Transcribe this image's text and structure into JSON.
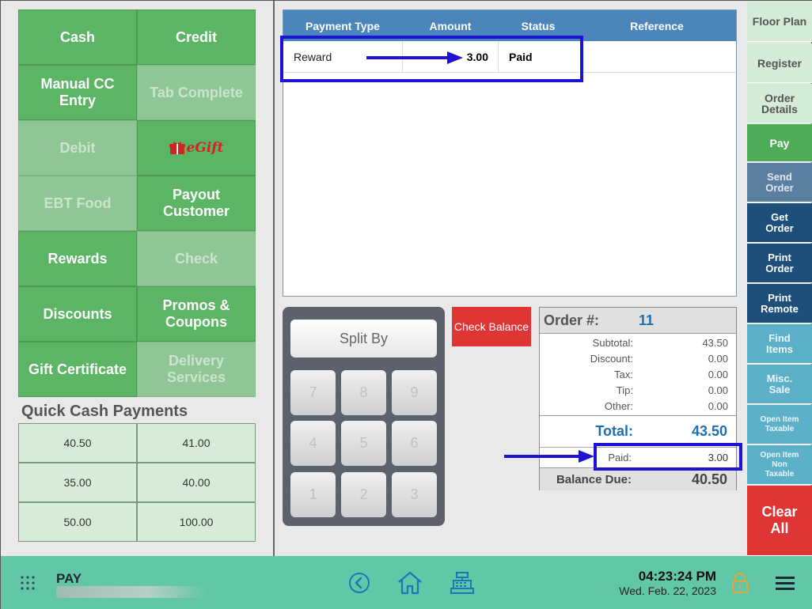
{
  "payment_buttons": [
    {
      "label": "Cash",
      "enabled": true
    },
    {
      "label": "Credit",
      "enabled": true
    },
    {
      "label": "Manual CC Entry",
      "enabled": true
    },
    {
      "label": "Tab Complete",
      "enabled": false
    },
    {
      "label": "Debit",
      "enabled": false
    },
    {
      "label": "eGift",
      "enabled": true
    },
    {
      "label": "EBT Food",
      "enabled": false
    },
    {
      "label": "Payout Customer",
      "enabled": true
    },
    {
      "label": "Rewards",
      "enabled": true
    },
    {
      "label": "Check",
      "enabled": false
    },
    {
      "label": "Discounts",
      "enabled": true
    },
    {
      "label": "Promos & Coupons",
      "enabled": true
    },
    {
      "label": "Gift Certificate",
      "enabled": true
    },
    {
      "label": "Delivery Services",
      "enabled": false
    }
  ],
  "quick_cash": {
    "title": "Quick Cash Payments",
    "amounts": [
      "40.50",
      "41.00",
      "35.00",
      "40.00",
      "50.00",
      "100.00"
    ]
  },
  "payment_table": {
    "headers": [
      "Payment Type",
      "Amount",
      "Status",
      "Reference"
    ],
    "rows": [
      {
        "type": "Reward",
        "amount": "3.00",
        "status": "Paid",
        "reference": ""
      }
    ]
  },
  "keypad": {
    "split_label": "Split By",
    "keys": [
      "7",
      "8",
      "9",
      "4",
      "5",
      "6",
      "1",
      "2",
      "3"
    ]
  },
  "check_balance_label": "Check Balance",
  "summary": {
    "order_label": "Order #:",
    "order_number": "11",
    "lines": [
      {
        "label": "Subtotal:",
        "value": "43.50"
      },
      {
        "label": "Discount:",
        "value": "0.00"
      },
      {
        "label": "Tax:",
        "value": "0.00"
      },
      {
        "label": "Tip:",
        "value": "0.00"
      },
      {
        "label": "Other:",
        "value": "0.00"
      }
    ],
    "total_label": "Total:",
    "total_value": "43.50",
    "paid_label": "Paid:",
    "paid_value": "3.00",
    "due_label": "Balance Due:",
    "due_value": "40.50"
  },
  "sidebar": [
    {
      "label": "Floor Plan",
      "style": "light"
    },
    {
      "label": "Register",
      "style": "light"
    },
    {
      "label": "Order Details",
      "style": "light"
    },
    {
      "label": "Pay",
      "style": "green"
    },
    {
      "label": "Send Order",
      "style": "slate"
    },
    {
      "label": "Get Order",
      "style": "navy"
    },
    {
      "label": "Print Order",
      "style": "navy"
    },
    {
      "label": "Print Remote",
      "style": "navy"
    },
    {
      "label": "Find Items",
      "style": "teal"
    },
    {
      "label": "Misc. Sale",
      "style": "teal"
    },
    {
      "label": "Open Item Taxable",
      "style": "teal-s"
    },
    {
      "label": "Open Item Non Taxable",
      "style": "teal-s"
    },
    {
      "label": "Clear All",
      "style": "red"
    }
  ],
  "bottom_bar": {
    "screen_title": "PAY",
    "time": "04:23:24 PM",
    "date": "Wed. Feb. 22, 2023"
  },
  "colors": {
    "pay_green": "#5cb565",
    "header_blue": "#4a85bb",
    "highlight_blue": "#1d12d6",
    "bottom_bar": "#62c7a6",
    "clear_red": "#e03535"
  }
}
